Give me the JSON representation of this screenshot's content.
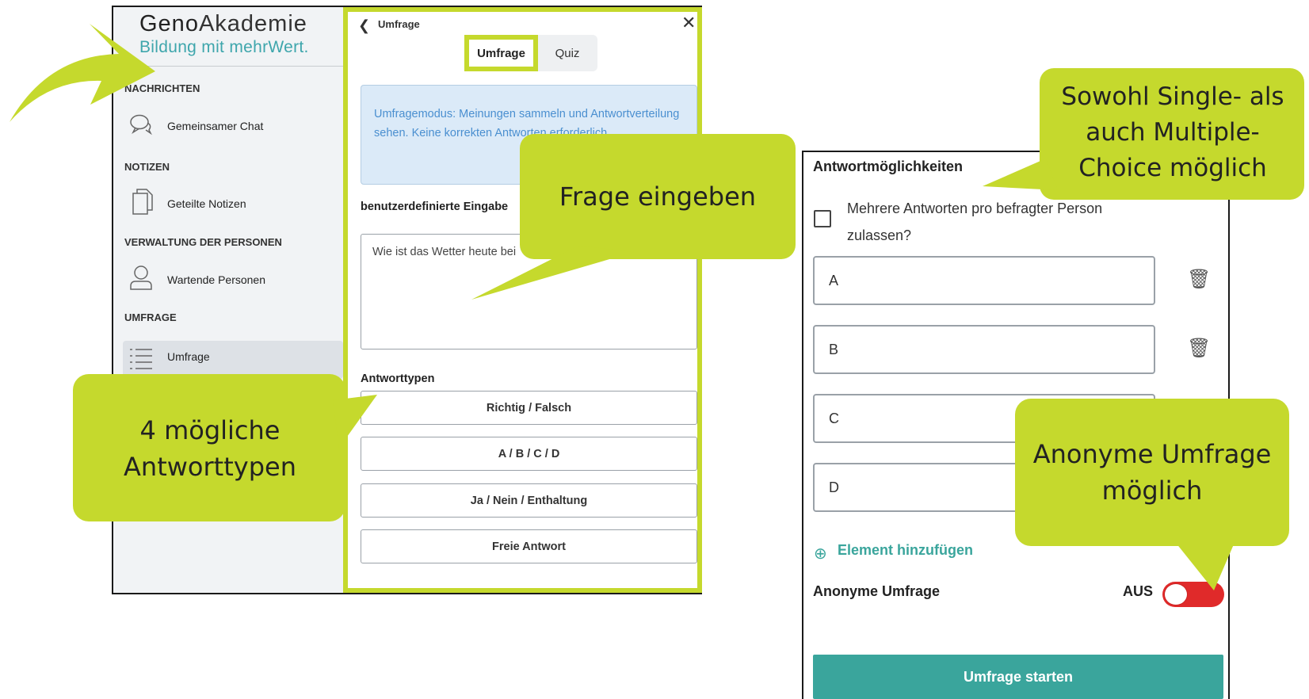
{
  "colors": {
    "highlight": "#c5d92d",
    "teal": "#3aa59c",
    "info_bg": "#dbeaf8",
    "toggle_off": "#e02a2a"
  },
  "logo": {
    "main_bold": "Geno",
    "main_light": "Akademie",
    "sub": "Bildung mit mehrWert."
  },
  "sidebar": {
    "sections": [
      {
        "title": "NACHRICHTEN",
        "item": "Gemeinsamer Chat",
        "icon": "chat-icon"
      },
      {
        "title": "NOTIZEN",
        "item": "Geteilte Notizen",
        "icon": "notes-icon"
      },
      {
        "title": "VERWALTUNG DER PERSONEN",
        "item": "Wartende Personen",
        "icon": "person-icon"
      },
      {
        "title": "UMFRAGE",
        "item": "Umfrage",
        "icon": "list-icon"
      }
    ]
  },
  "panel": {
    "title": "Umfrage",
    "tabs": [
      "Umfrage",
      "Quiz"
    ],
    "info": "Umfragemodus: Meinungen sammeln und Antwortverteilung sehen. Keine korrekten Antworten erforderlich.",
    "custom_label": "benutzerdefinierte Eingabe",
    "question_value": "Wie ist das Wetter heute bei",
    "types_label": "Antworttypen",
    "types": [
      "Richtig / Falsch",
      "A / B / C / D",
      "Ja / Nein / Enthaltung",
      "Freie Antwort"
    ]
  },
  "right": {
    "answers_label": "Antwortmöglichkeiten",
    "multi_label": "Mehrere Antworten pro befragter Person zulassen?",
    "options": [
      "A",
      "B",
      "C",
      "D"
    ],
    "add_label": "Element hinzufügen",
    "anon_label": "Anonyme Umfrage",
    "anon_state": "AUS",
    "start_label": "Umfrage starten"
  },
  "callouts": {
    "question": "Frage eingeben",
    "types": "4 mögliche Antworttypen",
    "choice": "Sowohl Single- als auch Multiple-Choice möglich",
    "anon": "Anonyme Umfrage möglich"
  }
}
